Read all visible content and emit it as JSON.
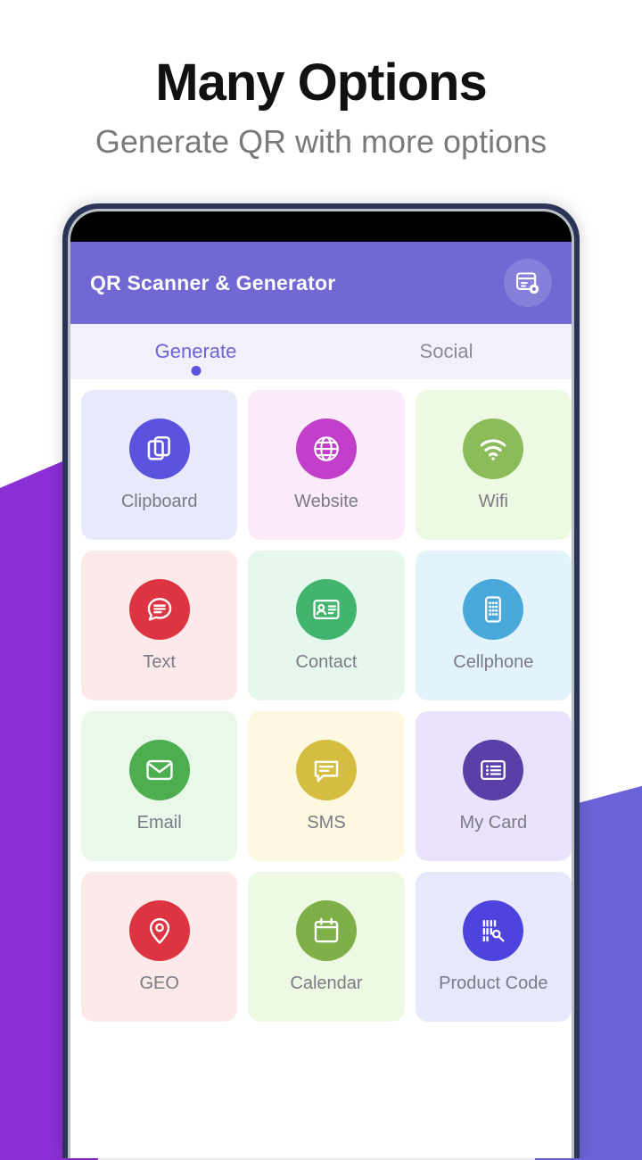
{
  "promo": {
    "title": "Many Options",
    "subtitle": "Generate QR with more options"
  },
  "app": {
    "title": "QR Scanner & Generator",
    "action_icon": "card-settings-icon"
  },
  "tabs": [
    {
      "label": "Generate",
      "active": true
    },
    {
      "label": "Social",
      "active": false
    }
  ],
  "grid": {
    "items": [
      {
        "label": "Clipboard",
        "icon": "clipboard-copy-icon",
        "circle_color": "#5B53DD",
        "card_color": "#E8EAFB"
      },
      {
        "label": "Website",
        "icon": "globe-icon",
        "circle_color": "#C13FC9",
        "card_color": "#FBEAFA"
      },
      {
        "label": "Wifi",
        "icon": "wifi-icon",
        "circle_color": "#8CBB5A",
        "card_color": "#EEF9E4"
      },
      {
        "label": "Text",
        "icon": "chat-bubble-icon",
        "circle_color": "#DC3440",
        "card_color": "#FCE9E9"
      },
      {
        "label": "Contact",
        "icon": "contact-card-icon",
        "circle_color": "#41B56E",
        "card_color": "#E6F8EE"
      },
      {
        "label": "Cellphone",
        "icon": "cellphone-icon",
        "circle_color": "#48A9DA",
        "card_color": "#E3F3FB"
      },
      {
        "label": "Email",
        "icon": "envelope-icon",
        "circle_color": "#4CAE4F",
        "card_color": "#E9F8E9"
      },
      {
        "label": "SMS",
        "icon": "sms-message-icon",
        "circle_color": "#D4BD40",
        "card_color": "#FDF8DF"
      },
      {
        "label": "My Card",
        "icon": "my-card-list-icon",
        "circle_color": "#5B3FA8",
        "card_color": "#EAE3FB"
      },
      {
        "label": "GEO",
        "icon": "map-pin-icon",
        "circle_color": "#DC3440",
        "card_color": "#FCE9E9"
      },
      {
        "label": "Calendar",
        "icon": "calendar-icon",
        "circle_color": "#7FAF49",
        "card_color": "#EEF9E4"
      },
      {
        "label": "Product Code",
        "icon": "barcode-scan-icon",
        "circle_color": "#4C44DC",
        "card_color": "#E7E8FB"
      }
    ]
  },
  "theme": {
    "appbar_color": "#7168D4",
    "accent_color": "#6C63D8",
    "tabbar_color": "#f1f0fb",
    "shape_left_color": "#8B2FD6",
    "shape_right_color": "#6C63D8"
  }
}
